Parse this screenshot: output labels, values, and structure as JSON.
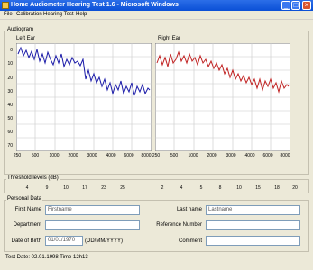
{
  "window": {
    "title": "Home Audiometer Hearing Test 1.6 - Microsoft Windows",
    "minimize": "_",
    "maximize": "□",
    "close": "×"
  },
  "menu": {
    "items": [
      "File",
      "Calibration",
      "Hearing Test",
      "Help"
    ]
  },
  "audiogram": {
    "group_label": "Audiogram",
    "left": {
      "label": "Left Ear"
    },
    "right": {
      "label": "Right Ear"
    },
    "y_ticks": [
      "0",
      "10",
      "20",
      "30",
      "40",
      "50",
      "60",
      "70"
    ],
    "x_ticks": [
      "250",
      "500",
      "1000",
      "2000",
      "3000",
      "4000",
      "6000",
      "8000"
    ],
    "left_color": "#1a1aa8",
    "right_color": "#c02020"
  },
  "thresholds": {
    "label": "Threshold levels (dB)",
    "left": [
      "4",
      "9",
      "10",
      "17",
      "23",
      "25"
    ],
    "right": [
      "2",
      "4",
      "5",
      "8",
      "10",
      "15",
      "18",
      "20"
    ]
  },
  "personal": {
    "label": "Personal Data",
    "first_name_label": "First Name",
    "first_name_value": "Firstname",
    "last_name_label": "Last name",
    "last_name_value": "Lastname",
    "department_label": "Department",
    "department_value": "",
    "reference_label": "Reference Number",
    "reference_value": "",
    "dob_label": "Date of Birth",
    "dob_value": "01/01/1970",
    "dob_format": "(DD/MM/YYYY)",
    "comment_label": "Comment",
    "comment_value": ""
  },
  "status": {
    "text": "Test Date: 02.01.1998 Time 12h13"
  }
}
